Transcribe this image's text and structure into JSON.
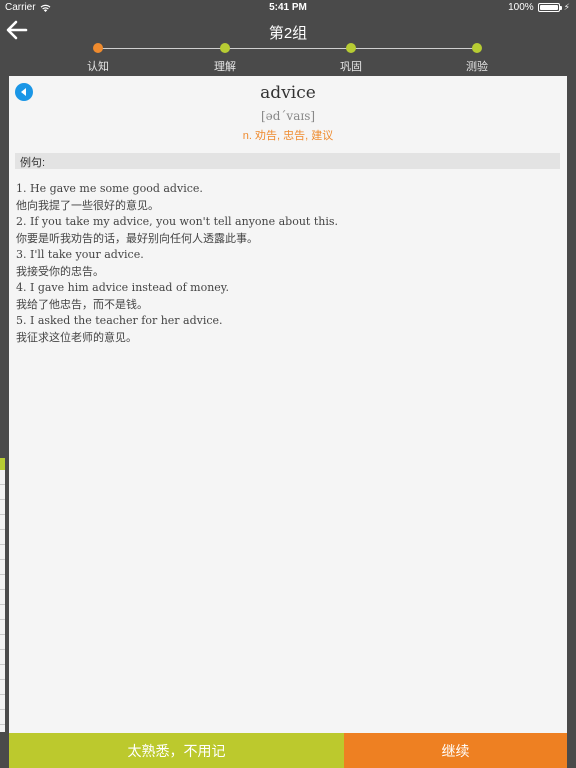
{
  "status_bar": {
    "carrier": "Carrier",
    "time": "5:41 PM",
    "battery": "100%",
    "battery_level": 1.0
  },
  "header": {
    "title": "第2组",
    "back_icon": "arrow-left-icon"
  },
  "progress": {
    "steps": [
      {
        "label": "认知",
        "color": "#ef8b2e",
        "active": true
      },
      {
        "label": "理解",
        "color": "#b7cc33",
        "active": false
      },
      {
        "label": "巩固",
        "color": "#b7cc33",
        "active": false
      },
      {
        "label": "测验",
        "color": "#b7cc33",
        "active": false
      }
    ]
  },
  "card": {
    "word": "advice",
    "phonetic": "[əd΄vaɪs]",
    "definition": "n. 劝告, 忠告, 建议",
    "audio_icon": "speaker-play-icon",
    "examples_header": "例句:",
    "examples": [
      {
        "en": "1. He gave me some good advice.",
        "zh": "他向我提了一些很好的意见。"
      },
      {
        "en": "2. If you take my advice, you won't tell anyone about this.",
        "zh": "你要是听我劝告的话，最好别向任何人透露此事。"
      },
      {
        "en": "3. I'll take your advice.",
        "zh": "我接受你的忠告。"
      },
      {
        "en": "4. I gave him advice instead of money.",
        "zh": "我给了他忠告，而不是钱。"
      },
      {
        "en": "5. I asked the teacher for her advice.",
        "zh": "我征求这位老师的意见。"
      }
    ]
  },
  "buttons": {
    "familiar_label": "太熟悉，不用记",
    "continue_label": "继续",
    "familiar_color": "#bcc92d",
    "continue_color": "#ee8022"
  }
}
